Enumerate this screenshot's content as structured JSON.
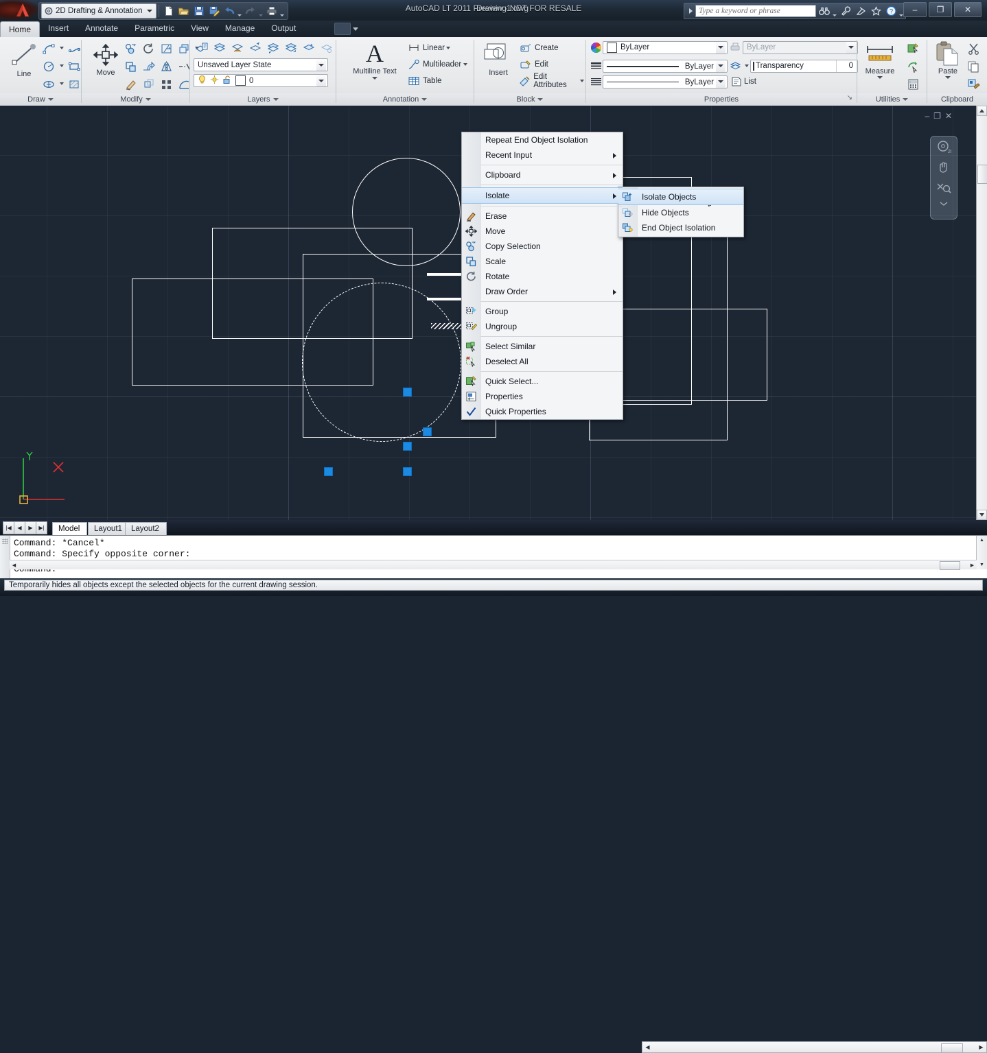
{
  "titlebar": {
    "workspace": "2D Drafting & Annotation",
    "app_title": "AutoCAD LT 2011 Preview - NOT FOR RESALE",
    "document_title": "Drawing1.dwg",
    "search_placeholder": "Type a keyword or phrase",
    "minimize": "–",
    "restore": "❐",
    "close": "✕",
    "quick_access": [
      "new-icon",
      "open-icon",
      "save-icon",
      "save-as-icon",
      "undo-icon",
      "redo-icon",
      "plot-icon"
    ],
    "help_icons": [
      "binoculars-icon",
      "wrench-icon",
      "satellite-icon",
      "star-icon",
      "help-icon"
    ]
  },
  "ribbon_tabs": [
    {
      "label": "Home",
      "active": true
    },
    {
      "label": "Insert",
      "active": false
    },
    {
      "label": "Annotate",
      "active": false
    },
    {
      "label": "Parametric",
      "active": false
    },
    {
      "label": "View",
      "active": false
    },
    {
      "label": "Manage",
      "active": false
    },
    {
      "label": "Output",
      "active": false
    }
  ],
  "panels": {
    "draw": {
      "title": "Draw",
      "big_button": "Line"
    },
    "modify": {
      "title": "Modify",
      "big_button": "Move"
    },
    "layers": {
      "title": "Layers",
      "layer_state": "Unsaved Layer State",
      "current_layer": "0"
    },
    "annotation": {
      "title": "Annotation",
      "big_button": "Multiline Text",
      "items": [
        "Linear",
        "Multileader",
        "Table"
      ]
    },
    "block": {
      "title": "Block",
      "big_button": "Insert",
      "items": [
        "Create",
        "Edit",
        "Edit Attributes"
      ]
    },
    "properties": {
      "title": "Properties",
      "color": "ByLayer",
      "plotstyle": "ByLayer",
      "linetype": "ByLayer",
      "lineweight": "ByLayer",
      "transparency_label": "Transparency",
      "transparency_value": "0",
      "list_label": "List"
    },
    "utilities": {
      "title": "Utilities",
      "big_button": "Measure"
    },
    "clipboard": {
      "title": "Clipboard",
      "big_button": "Paste"
    }
  },
  "context_menu": {
    "items": [
      {
        "label": "Repeat End Object Isolation",
        "icon": "",
        "submenu": false,
        "separator_after": false
      },
      {
        "label": "Recent Input",
        "icon": "",
        "submenu": true,
        "separator_after": true
      },
      {
        "label": "Clipboard",
        "icon": "",
        "submenu": true,
        "separator_after": true
      },
      {
        "label": "Isolate",
        "icon": "",
        "submenu": true,
        "highlighted": true,
        "separator_after": true
      },
      {
        "label": "Erase",
        "icon": "eraser-icon",
        "submenu": false
      },
      {
        "label": "Move",
        "icon": "move-icon",
        "submenu": false
      },
      {
        "label": "Copy Selection",
        "icon": "copy-icon",
        "submenu": false
      },
      {
        "label": "Scale",
        "icon": "scale-icon",
        "submenu": false
      },
      {
        "label": "Rotate",
        "icon": "rotate-icon",
        "submenu": false
      },
      {
        "label": "Draw Order",
        "icon": "",
        "submenu": true,
        "separator_after": true
      },
      {
        "label": "Group",
        "icon": "group-icon",
        "submenu": false
      },
      {
        "label": "Ungroup",
        "icon": "ungroup-icon",
        "submenu": false,
        "separator_after": true
      },
      {
        "label": "Select Similar",
        "icon": "select-similar-icon",
        "submenu": false
      },
      {
        "label": "Deselect All",
        "icon": "deselect-all-icon",
        "submenu": false,
        "separator_after": true
      },
      {
        "label": "Quick Select...",
        "icon": "quick-select-icon",
        "submenu": false
      },
      {
        "label": "Properties",
        "icon": "properties-icon",
        "submenu": false
      },
      {
        "label": "Quick Properties",
        "icon": "checkmark-icon",
        "submenu": false,
        "checked": true
      }
    ]
  },
  "submenu": {
    "items": [
      {
        "label": "Isolate Objects",
        "icon": "isolate-objects-icon",
        "highlighted": true
      },
      {
        "label": "Hide Objects",
        "icon": "hide-objects-icon",
        "highlighted": false
      },
      {
        "label": "End Object Isolation",
        "icon": "end-isolation-icon",
        "highlighted": false
      }
    ]
  },
  "layout_tabs": [
    {
      "label": "Model",
      "selected": true
    },
    {
      "label": "Layout1",
      "selected": false
    },
    {
      "label": "Layout2",
      "selected": false
    }
  ],
  "command_line": {
    "lines": [
      "Command: *Cancel*",
      "Command: Specify opposite corner:",
      "",
      "Command:"
    ]
  },
  "status_tooltip": "Temporarily hides all objects except the selected objects for the current drawing session.",
  "colors": {
    "canvas_bg": "#1d2633",
    "geometry": "#ffffff",
    "grip": "#1a8ae5",
    "ucs_y_axis": "#2ecc40",
    "ucs_x_axis": "#e03030",
    "highlight": "#cfe3f6"
  }
}
